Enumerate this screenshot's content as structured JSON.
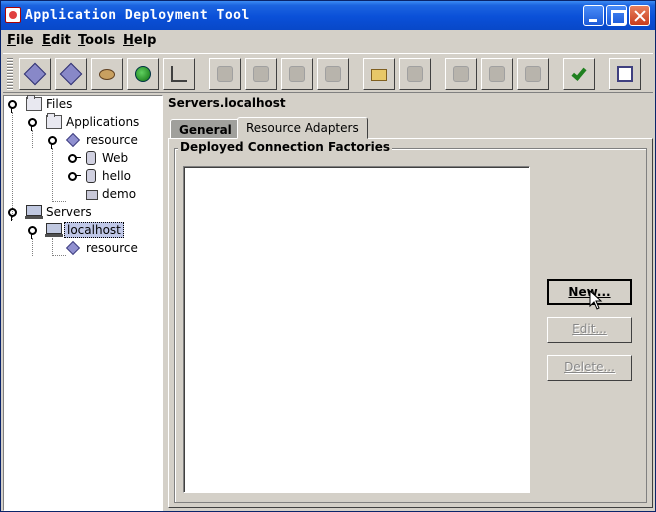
{
  "window": {
    "title": "Application Deployment Tool"
  },
  "menu": {
    "items": [
      "File",
      "Edit",
      "Tools",
      "Help"
    ]
  },
  "toolbar": {
    "buttons": [
      {
        "icon": "diamond-new-icon",
        "enabled": true
      },
      {
        "icon": "diamond-open-icon",
        "enabled": true
      },
      {
        "icon": "bean-icon",
        "enabled": true
      },
      {
        "icon": "globe-icon",
        "enabled": true
      },
      {
        "icon": "tree-icon",
        "enabled": true
      },
      {
        "icon": "edit-icon",
        "enabled": false
      },
      {
        "icon": "jar-icon",
        "enabled": false
      },
      {
        "icon": "jar-add-icon",
        "enabled": false
      },
      {
        "icon": "jar-remove-icon",
        "enabled": false
      },
      {
        "icon": "folder-open-icon",
        "enabled": true
      },
      {
        "icon": "save-icon",
        "enabled": false
      },
      {
        "icon": "deploy-icon",
        "enabled": false
      },
      {
        "icon": "undeploy-icon",
        "enabled": false
      },
      {
        "icon": "update-icon",
        "enabled": false
      },
      {
        "icon": "verify-check-icon",
        "enabled": true
      },
      {
        "icon": "window-icon",
        "enabled": true
      }
    ]
  },
  "tree": {
    "files": "Files",
    "applications": "Applications",
    "resource_app": "resource",
    "web": "Web",
    "hello": "hello",
    "demo": "demo",
    "servers": "Servers",
    "localhost": "localhost",
    "resource_server": "resource"
  },
  "panel": {
    "title": "Servers.localhost",
    "tabs": [
      "General",
      "Resource Adapters"
    ],
    "active_tab": "Resource Adapters",
    "group_label": "Deployed Connection Factories",
    "buttons": {
      "new": "New...",
      "edit": "Edit...",
      "delete": "Delete..."
    }
  }
}
